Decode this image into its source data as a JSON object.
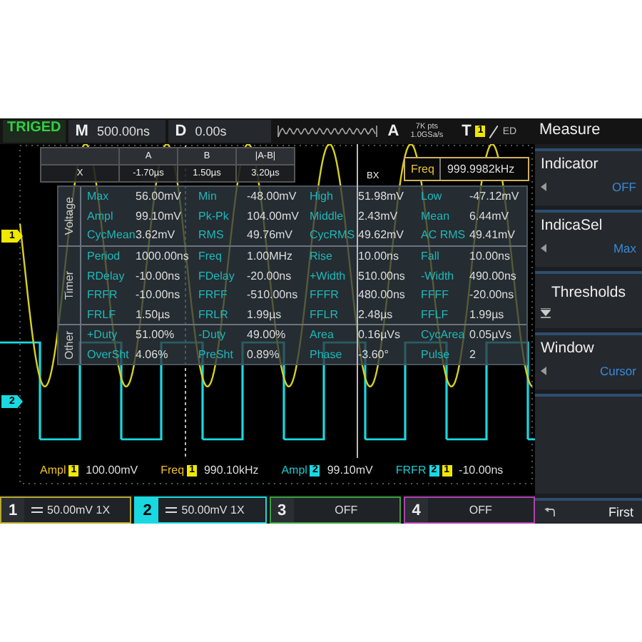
{
  "top_bar": {
    "trigger_status": "TRIGED",
    "timebase": {
      "label": "M",
      "value": "500.00ns"
    },
    "delay": {
      "label": "D",
      "value": "0.00s"
    },
    "acquire": {
      "label": "A",
      "points": "7K pts",
      "rate": "1.0GSa/s"
    },
    "trigger": {
      "label": "T",
      "source": "1",
      "color": "#f0e800",
      "mode": "ED"
    }
  },
  "cursor_table": {
    "columns": [
      "A",
      "B",
      "|A-B|"
    ],
    "rows": [
      {
        "label": "X",
        "values": [
          "-1.70µs",
          "1.50µs",
          "3.20µs"
        ]
      }
    ]
  },
  "cursor_label": "BX",
  "freq_readout": {
    "label": "Freq",
    "value": "999.9982kHz"
  },
  "measure_panel": {
    "groups": [
      {
        "name": "Voltage",
        "rows": [
          [
            {
              "label": "Max",
              "value": "56.00mV"
            },
            {
              "label": "Min",
              "value": "-48.00mV"
            },
            {
              "label": "High",
              "value": "51.98mV"
            },
            {
              "label": "Low",
              "value": "-47.12mV"
            }
          ],
          [
            {
              "label": "Ampl",
              "value": "99.10mV"
            },
            {
              "label": "Pk-Pk",
              "value": "104.00mV"
            },
            {
              "label": "Middle",
              "value": "2.43mV"
            },
            {
              "label": "Mean",
              "value": "6.44mV"
            }
          ],
          [
            {
              "label": "CycMean",
              "value": "3.62mV"
            },
            {
              "label": "RMS",
              "value": "49.76mV"
            },
            {
              "label": "CycRMS",
              "value": "49.62mV"
            },
            {
              "label": "AC RMS",
              "value": "49.41mV"
            }
          ]
        ]
      },
      {
        "name": "Timer",
        "rows": [
          [
            {
              "label": "Period",
              "value": "1000.00ns"
            },
            {
              "label": "Freq",
              "value": "1.00MHz"
            },
            {
              "label": "Rise",
              "value": "10.00ns"
            },
            {
              "label": "Fall",
              "value": "10.00ns"
            }
          ],
          [
            {
              "label": "RDelay",
              "value": "-10.00ns"
            },
            {
              "label": "FDelay",
              "value": "-20.00ns"
            },
            {
              "label": "+Width",
              "value": "510.00ns"
            },
            {
              "label": "-Width",
              "value": "490.00ns"
            }
          ],
          [
            {
              "label": "FRFR",
              "value": "-10.00ns"
            },
            {
              "label": "FRFF",
              "value": "-510.00ns"
            },
            {
              "label": "FFFR",
              "value": "480.00ns"
            },
            {
              "label": "FFFF",
              "value": "-20.00ns"
            }
          ],
          [
            {
              "label": "FRLF",
              "value": "1.50µs"
            },
            {
              "label": "FRLR",
              "value": "1.99µs"
            },
            {
              "label": "FFLR",
              "value": "2.48µs"
            },
            {
              "label": "FFLF",
              "value": "1.99µs"
            }
          ]
        ]
      },
      {
        "name": "Other",
        "rows": [
          [
            {
              "label": "+Duty",
              "value": "51.00%"
            },
            {
              "label": "-Duty",
              "value": "49.00%"
            },
            {
              "label": "Area",
              "value": "0.16µVs"
            },
            {
              "label": "CycArea",
              "value": "0.05µVs"
            }
          ],
          [
            {
              "label": "OverSht",
              "value": "4.06%"
            },
            {
              "label": "PreSht",
              "value": "0.89%"
            },
            {
              "label": "Phase",
              "value": "-3.60°"
            },
            {
              "label": "Pulse",
              "value": "2"
            }
          ]
        ]
      }
    ]
  },
  "channel_markers": [
    {
      "label": "1",
      "color": "#f0e800"
    },
    {
      "label": "2",
      "color": "#19d8e0"
    }
  ],
  "bottom_readouts": [
    {
      "label": "Ampl",
      "color": "#f0c020",
      "sources": [
        {
          "label": "1",
          "color": "#f0e800"
        }
      ],
      "value": "100.00mV"
    },
    {
      "label": "Freq",
      "color": "#f0c020",
      "sources": [
        {
          "label": "1",
          "color": "#f0e800"
        }
      ],
      "value": "990.10kHz"
    },
    {
      "label": "Ampl",
      "color": "#19c8d0",
      "sources": [
        {
          "label": "2",
          "color": "#19d8e0"
        }
      ],
      "value": "99.10mV"
    },
    {
      "label": "FRFR",
      "color": "#19c8d0",
      "sources": [
        {
          "label": "2",
          "color": "#19d8e0"
        },
        {
          "label": "1",
          "color": "#f0e800"
        }
      ],
      "value": "-10.00ns"
    }
  ],
  "channels": [
    {
      "number": "1",
      "kind": "dc",
      "setting": "50.00mV 1X",
      "color": "#b8a830",
      "selected": false
    },
    {
      "number": "2",
      "kind": "dc",
      "setting": "50.00mV 1X",
      "color": "#19d8e0",
      "selected": true
    },
    {
      "number": "3",
      "kind": "off",
      "setting": "OFF",
      "color": "#3aa040",
      "selected": false
    },
    {
      "number": "4",
      "kind": "off",
      "setting": "OFF",
      "color": "#b040b0",
      "selected": false
    }
  ],
  "menu": {
    "title": "Measure",
    "items": [
      {
        "kind": "option",
        "label": "Indicator",
        "value": "OFF"
      },
      {
        "kind": "option",
        "label": "IndicaSel",
        "value": "Max"
      },
      {
        "kind": "submenu",
        "label": "Thresholds"
      },
      {
        "kind": "option",
        "label": "Window",
        "value": "Cursor"
      }
    ],
    "footer": {
      "label": "First"
    }
  }
}
